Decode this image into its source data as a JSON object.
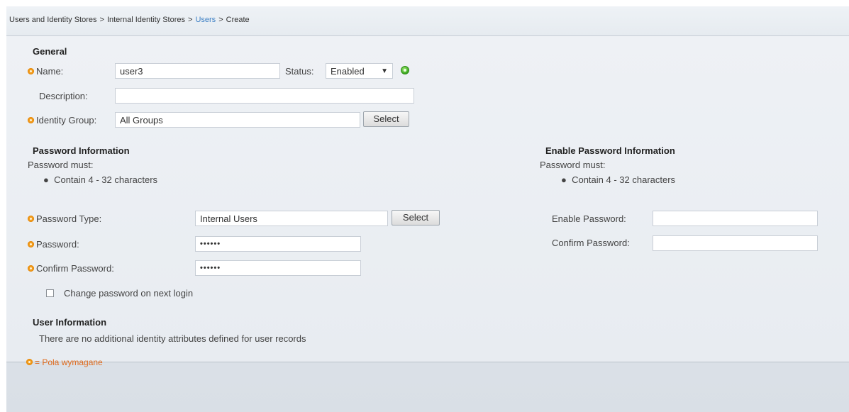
{
  "breadcrumb": {
    "items": [
      "Users and Identity Stores",
      "Internal Identity Stores",
      "Users",
      "Create"
    ],
    "separator": ">"
  },
  "general": {
    "heading": "General",
    "name_label": "Name:",
    "name_value": "user3",
    "status_label": "Status:",
    "status_value": "Enabled",
    "description_label": "Description:",
    "description_value": "",
    "identity_group_label": "Identity Group:",
    "identity_group_value": "All Groups",
    "select_label": "Select"
  },
  "password_info": {
    "heading": "Password Information",
    "must_label": "Password must:",
    "rule": "Contain 4 - 32 characters",
    "type_label": "Password Type:",
    "type_value": "Internal Users",
    "select_label": "Select",
    "password_label": "Password:",
    "password_value": "••••••",
    "confirm_label": "Confirm Password:",
    "confirm_value": "••••••",
    "change_on_login_label": "Change password on next login",
    "change_on_login_checked": false
  },
  "enable_password_info": {
    "heading": "Enable Password Information",
    "must_label": "Password must:",
    "rule": "Contain 4 - 32 characters",
    "enable_label": "Enable Password:",
    "enable_value": "",
    "confirm_label": "Confirm Password:",
    "confirm_value": ""
  },
  "user_info": {
    "heading": "User Information",
    "text": "There are no additional identity attributes defined for user records"
  },
  "legend": {
    "text": "= Pola wymagane"
  },
  "colors": {
    "required_icon": "#f29c1c",
    "link": "#3b7fc4",
    "legend_text": "#e06a1b",
    "status_enabled": "#3aa81f"
  },
  "icons": {
    "required": "required-field-icon",
    "status": "status-enabled-icon",
    "dropdown": "chevron-down-icon"
  }
}
